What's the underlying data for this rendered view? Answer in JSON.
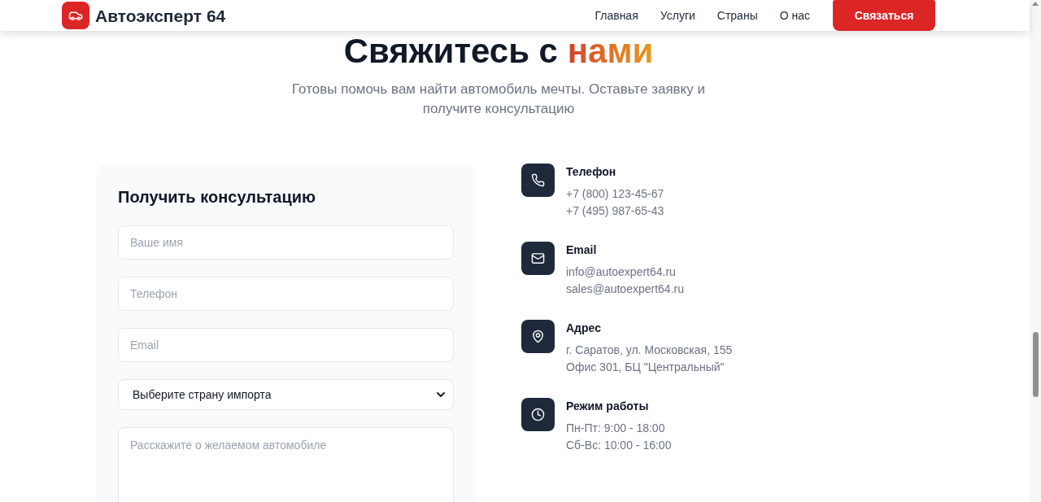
{
  "header": {
    "brand": "Автоэксперт 64",
    "nav": [
      {
        "label": "Главная"
      },
      {
        "label": "Услуги"
      },
      {
        "label": "Страны"
      },
      {
        "label": "О нас"
      }
    ],
    "cta": "Связаться"
  },
  "hero": {
    "title": "Свяжитесь с",
    "title_highlight": "нами",
    "subtitle": "Готовы помочь вам найти автомобиль мечты. Оставьте заявку и получите консультацию"
  },
  "form": {
    "title": "Получить консультацию",
    "fields": [
      {
        "kind": "input",
        "placeholder": "Ваше имя"
      },
      {
        "kind": "input",
        "placeholder": "Телефон"
      },
      {
        "kind": "input",
        "placeholder": "Email"
      },
      {
        "kind": "select",
        "value": "Выберите страну импорта"
      },
      {
        "kind": "textarea",
        "placeholder": "Расскажите о желаемом автомобиле"
      }
    ]
  },
  "contacts": [
    {
      "kind": "phone",
      "title": "Телефон",
      "lines": [
        "+7 (800) 123-45-67",
        "+7 (495) 987-65-43"
      ]
    },
    {
      "kind": "email",
      "title": "Email",
      "lines": [
        "info@autoexpert64.ru",
        "sales@autoexpert64.ru"
      ]
    },
    {
      "kind": "address",
      "title": "Адрес",
      "lines": [
        "г. Саратов, ул. Московская, 155",
        "Офис 301, БЦ \"Центральный\""
      ]
    },
    {
      "kind": "hours",
      "title": "Режим работы",
      "lines": [
        "Пн-Пт: 9:00 - 18:00",
        "Сб-Вс: 10:00 - 16:00"
      ]
    }
  ]
}
